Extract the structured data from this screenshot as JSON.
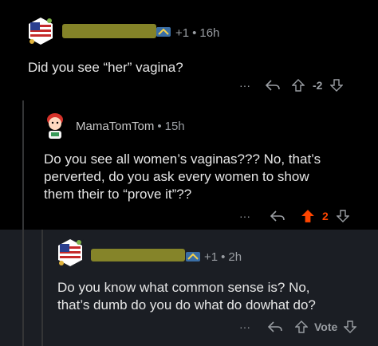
{
  "comments": [
    {
      "awards": "+1",
      "time": "16h",
      "body": "Did you see “her” vagina?",
      "score": "-2",
      "more": "···"
    },
    {
      "username": "MamaTomTom",
      "time": "15h",
      "body_lines": [
        "Do you see all women’s vaginas??? No, that’s",
        "perverted, do you ask every women to show",
        "them their to “prove it”??"
      ],
      "score": "2",
      "more": "···"
    },
    {
      "awards": "+1",
      "time": "2h",
      "body_lines": [
        "Do you know what common sense is? No,",
        "that’s dumb do you do what do dowhat do?"
      ],
      "vote_label": "Vote",
      "more": "···"
    }
  ],
  "colors": {
    "upvote_active": "#ff4500",
    "redaction": "#8b8a2a",
    "highlight_bg": "#1b1e24"
  },
  "icons": [
    "avatar-flag-icon",
    "award-icon",
    "reply-icon",
    "upvote-icon",
    "downvote-icon",
    "more-icon"
  ]
}
